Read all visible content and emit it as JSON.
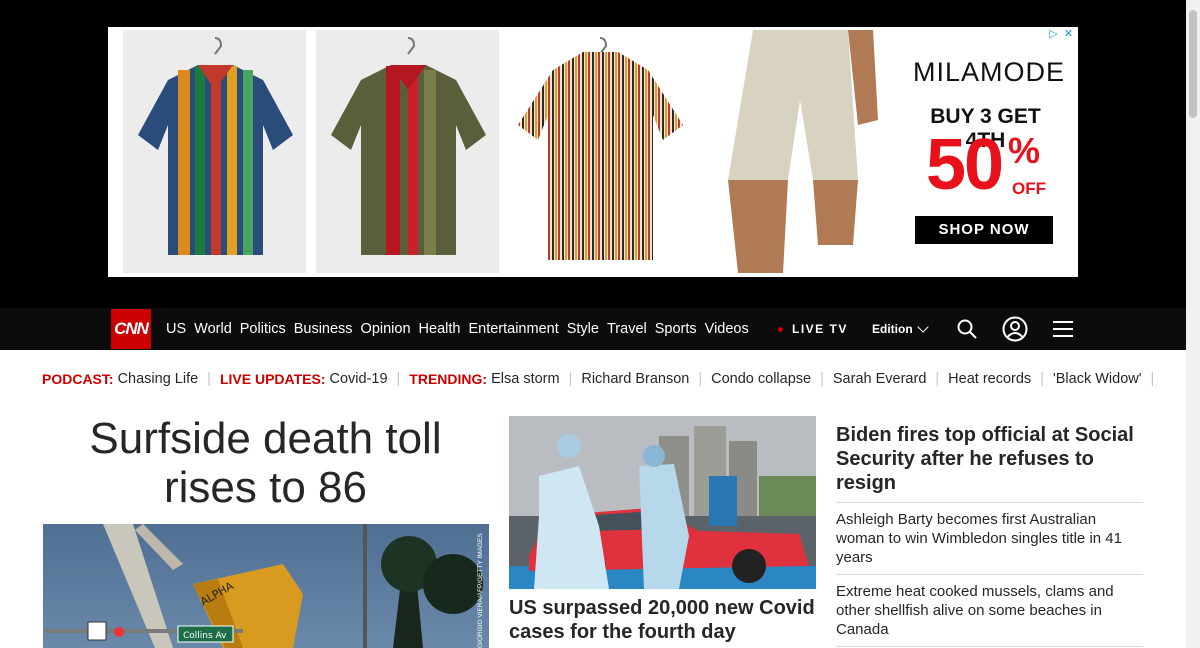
{
  "ad": {
    "brand": "MILAMODE",
    "offer_line": "BUY 3 GET 4TH",
    "discount": "50",
    "percent_sign": "%",
    "off": "OFF",
    "cta": "SHOP NOW",
    "adchoices_icon": "adchoices-icon",
    "close_icon": "close-icon",
    "adchoices_glyph": "▷",
    "close_glyph": "✕"
  },
  "nav": {
    "logo": "CNN",
    "links": [
      "US",
      "World",
      "Politics",
      "Business",
      "Opinion",
      "Health",
      "Entertainment",
      "Style",
      "Travel",
      "Sports",
      "Videos"
    ],
    "live_tv": "LIVE TV",
    "edition": "Edition",
    "search_icon": "search-icon",
    "account_icon": "user-account-icon",
    "menu_icon": "hamburger-menu-icon"
  },
  "trending": [
    {
      "prefix": "PODCAST:",
      "text": "Chasing Life"
    },
    {
      "prefix": "LIVE UPDATES:",
      "text": "Covid-19"
    },
    {
      "prefix": "TRENDING:",
      "text": "Elsa storm"
    },
    {
      "prefix": "",
      "text": "Richard Branson"
    },
    {
      "prefix": "",
      "text": "Condo collapse"
    },
    {
      "prefix": "",
      "text": "Sarah Everard"
    },
    {
      "prefix": "",
      "text": "Heat records"
    },
    {
      "prefix": "",
      "text": "'Black Widow'"
    }
  ],
  "main": {
    "headline": "Surfside death toll rises to 86",
    "image_credit": "GIORGIO VIERA/AFP/GETTY IMAGES",
    "street_sign": "Collins Av",
    "crane_text": "ALPHA"
  },
  "mid": {
    "headline": "US surpassed 20,000 new Covid cases for the fourth day"
  },
  "right": {
    "headline": "Biden fires top official at Social Security after he refuses to resign",
    "stories": [
      "Ashleigh Barty becomes first Australian woman to win Wimbledon singles title in 41 years",
      "Extreme heat cooked mussels, clams and other shellfish alive on some beaches in Canada"
    ]
  },
  "colors": {
    "brand_red": "#cc0000",
    "ad_red": "#e8101b",
    "nav_bg": "#0c0c0c",
    "text": "#262626"
  }
}
